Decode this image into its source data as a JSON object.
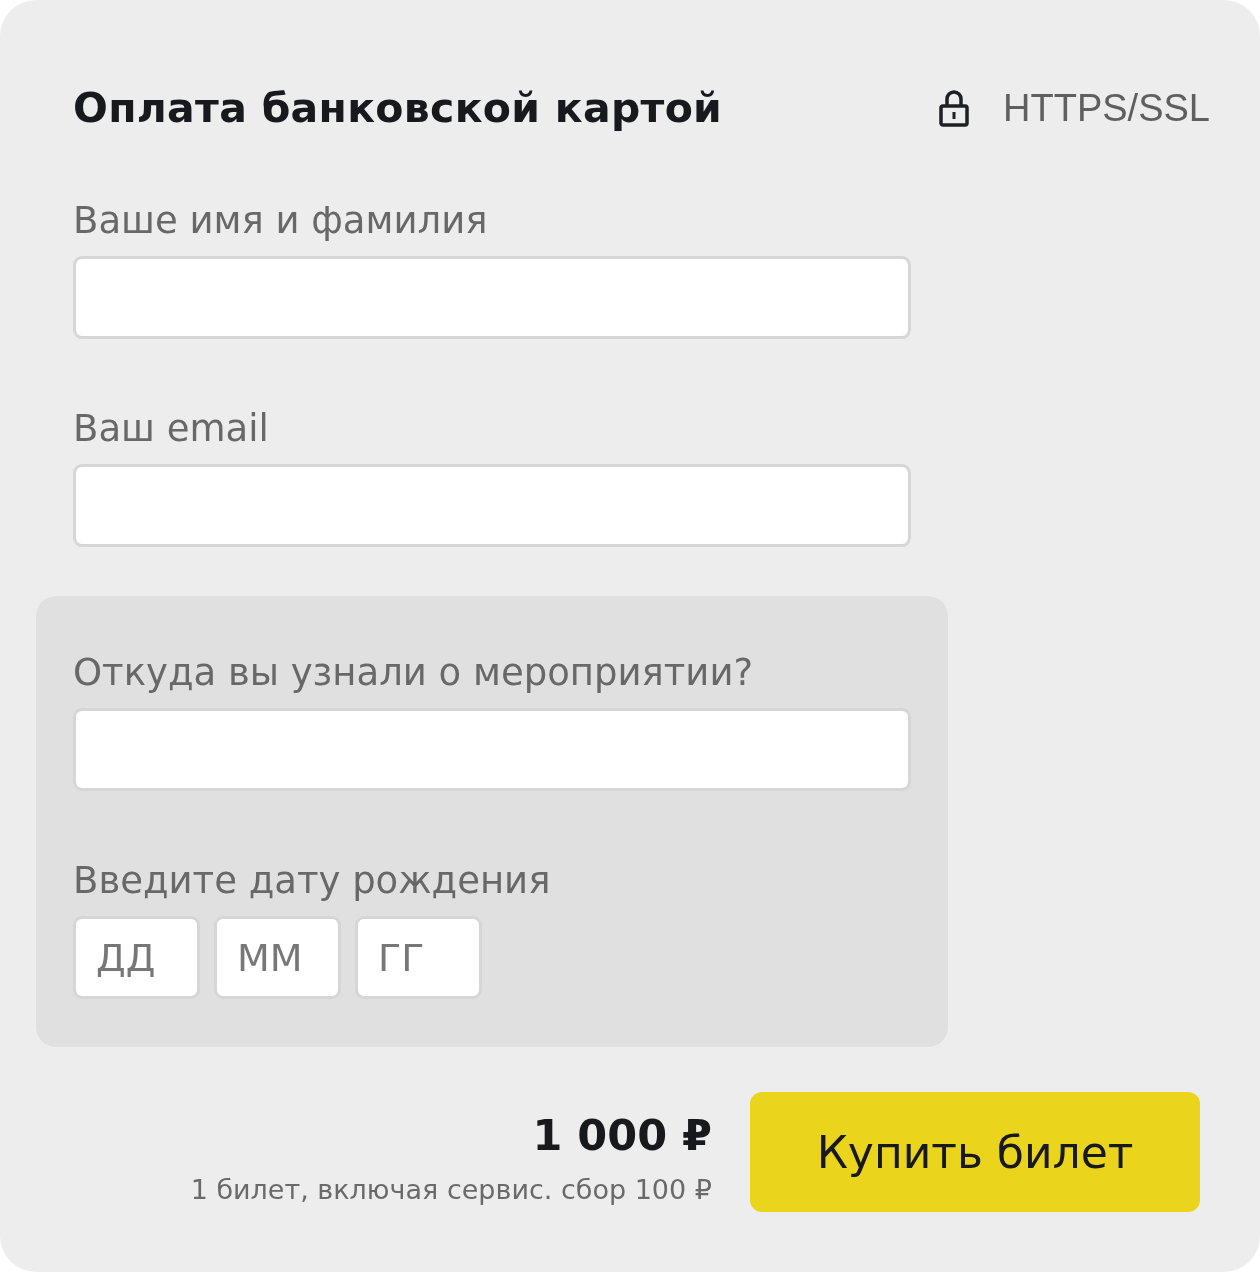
{
  "header": {
    "title": "Оплата банковской картой",
    "security": "HTTPS/SSL"
  },
  "fields": [
    {
      "label": "Ваше имя и фамилия"
    },
    {
      "label": "Ваш email"
    }
  ],
  "extra": {
    "fields": [
      {
        "label": "Откуда вы узнали о мероприятии?"
      }
    ],
    "birthdate": {
      "label": "Введите дату рождения",
      "parts": [
        {
          "placeholder": "ДД"
        },
        {
          "placeholder": "ММ"
        },
        {
          "placeholder": "ГГ"
        }
      ]
    }
  },
  "footer": {
    "price": "1 000 ₽",
    "note": "1 билет, включая сервис. сбор 100 ₽",
    "button": "Купить билет"
  }
}
